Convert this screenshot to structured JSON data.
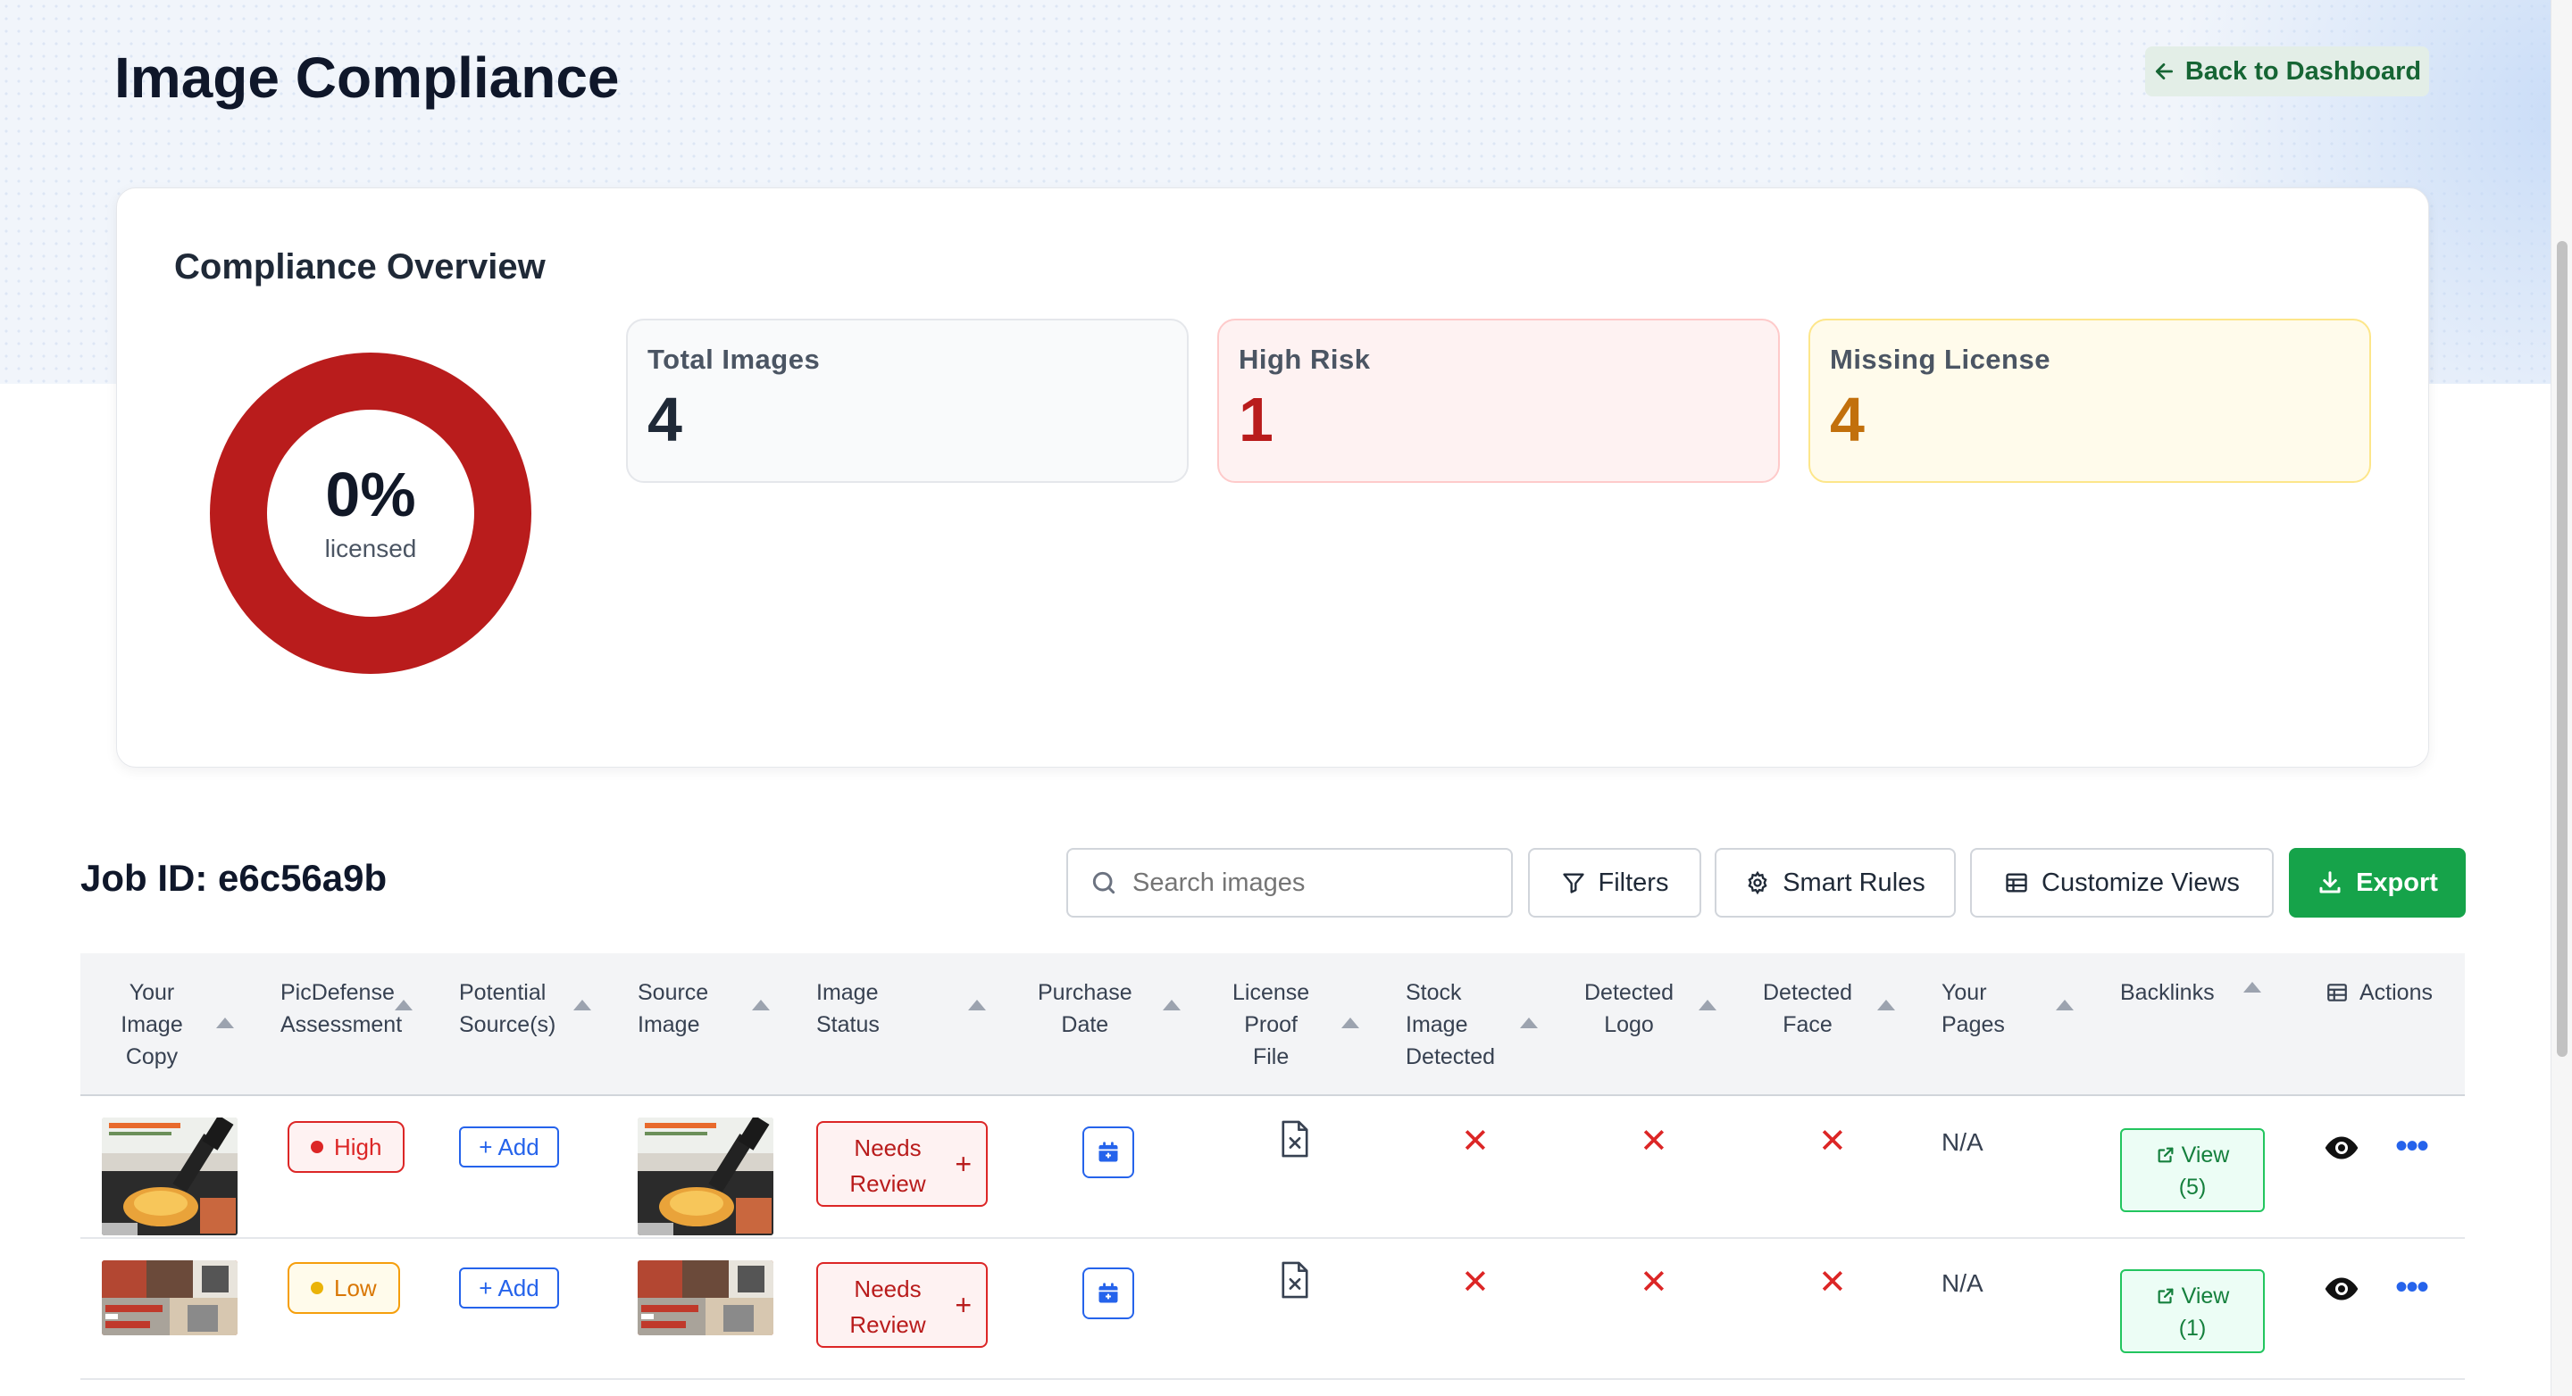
{
  "header": {
    "title": "Image Compliance",
    "back_label": "Back to Dashboard"
  },
  "overview": {
    "title": "Compliance Overview",
    "donut_percent": "0%",
    "donut_label": "licensed",
    "licensed_fraction": 0,
    "stats": [
      {
        "label": "Total Images",
        "value": "4"
      },
      {
        "label": "High Risk",
        "value": "1"
      },
      {
        "label": "Missing License",
        "value": "4"
      }
    ]
  },
  "toolbar": {
    "job_id": "Job ID: e6c56a9b",
    "search_placeholder": "Search images",
    "filters": "Filters",
    "smart_rules": "Smart Rules",
    "customize_views": "Customize Views",
    "export": "Export"
  },
  "table": {
    "columns": [
      [
        "Your",
        "Image",
        "Copy"
      ],
      [
        "PicDefense",
        "Assessment"
      ],
      [
        "Potential",
        "Source(s)"
      ],
      [
        "Source",
        "Image"
      ],
      [
        "Image",
        "Status"
      ],
      [
        "Purchase",
        "Date"
      ],
      [
        "License",
        "Proof",
        "File"
      ],
      [
        "Stock",
        "Image",
        "Detected"
      ],
      [
        "Detected",
        "Logo"
      ],
      [
        "Detected",
        "Face"
      ],
      [
        "Your",
        "Pages"
      ],
      [
        "Backlinks"
      ],
      [
        "Actions"
      ]
    ],
    "rows": [
      {
        "assessment": "High",
        "add_label": "Add",
        "status_line1": "Needs",
        "status_line2": "Review",
        "your_pages": "N/A",
        "backlinks_line1": "View",
        "backlinks_line2": "(5)"
      },
      {
        "assessment": "Low",
        "add_label": "Add",
        "status_line1": "Needs",
        "status_line2": "Review",
        "your_pages": "N/A",
        "backlinks_line1": "View",
        "backlinks_line2": "(1)"
      }
    ]
  },
  "colors": {
    "accent_green": "#16a34a",
    "danger_red": "#b91c1c",
    "warning_amber": "#c2700c",
    "link_blue": "#2563eb"
  }
}
